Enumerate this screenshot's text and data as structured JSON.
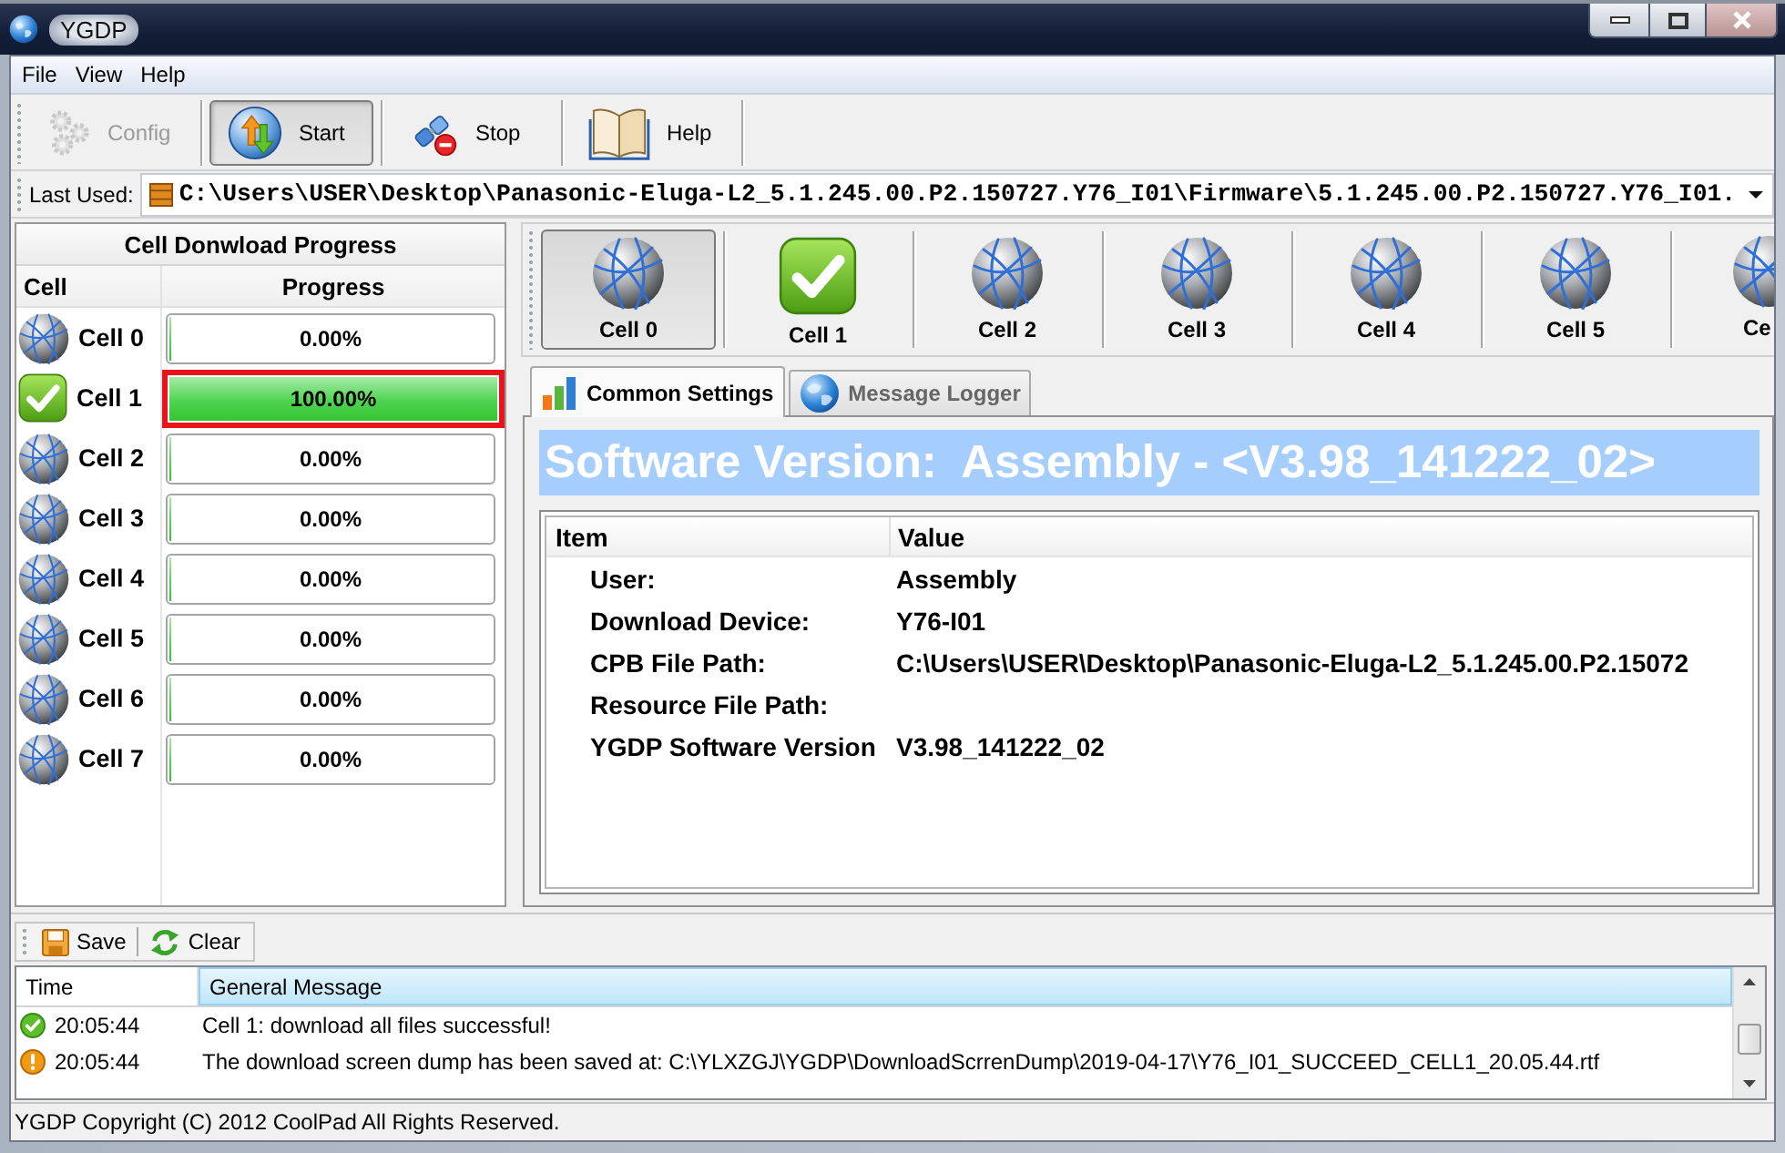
{
  "window": {
    "title": "YGDP"
  },
  "menu": [
    "File",
    "View",
    "Help"
  ],
  "toolbar": [
    {
      "label": "Config",
      "disabled": true,
      "pressed": false
    },
    {
      "label": "Start",
      "disabled": false,
      "pressed": true
    },
    {
      "label": "Stop",
      "disabled": false,
      "pressed": false
    },
    {
      "label": "Help",
      "disabled": false,
      "pressed": false
    }
  ],
  "last_used": {
    "label": "Last Used:",
    "value": "C:\\Users\\USER\\Desktop\\Panasonic-Eluga-L2_5.1.245.00.P2.150727.Y76_I01\\Firmware\\5.1.245.00.P2.150727.Y76_I01."
  },
  "progress_panel": {
    "title": "Cell Donwload Progress",
    "columns": [
      "Cell",
      "Progress"
    ],
    "rows": [
      {
        "name": "Cell 0",
        "done": false,
        "level": 0,
        "reading": "0.00%",
        "selected": false
      },
      {
        "name": "Cell 1",
        "done": true,
        "level": 1,
        "reading": "100.00%",
        "selected": true
      },
      {
        "name": "Cell 2",
        "done": false,
        "level": 0,
        "reading": "0.00%",
        "selected": false
      },
      {
        "name": "Cell 3",
        "done": false,
        "level": 0,
        "reading": "0.00%",
        "selected": false
      },
      {
        "name": "Cell 4",
        "done": false,
        "level": 0,
        "reading": "0.00%",
        "selected": false
      },
      {
        "name": "Cell 5",
        "done": false,
        "level": 0,
        "reading": "0.00%",
        "selected": false
      },
      {
        "name": "Cell 6",
        "done": false,
        "level": 0,
        "reading": "0.00%",
        "selected": false
      },
      {
        "name": "Cell 7",
        "done": false,
        "level": 0,
        "reading": "0.00%",
        "selected": false
      }
    ]
  },
  "cell_bar": [
    {
      "label": "Cell 0",
      "done": false,
      "selected": true
    },
    {
      "label": "Cell 1",
      "done": true,
      "selected": false
    },
    {
      "label": "Cell 2",
      "done": false,
      "selected": false
    },
    {
      "label": "Cell 3",
      "done": false,
      "selected": false
    },
    {
      "label": "Cell 4",
      "done": false,
      "selected": false
    },
    {
      "label": "Cell 5",
      "done": false,
      "selected": false
    },
    {
      "label": "Ce",
      "done": false,
      "selected": false
    }
  ],
  "tabs": [
    {
      "label": "Common Settings",
      "selected": true
    },
    {
      "label": "Message Logger",
      "selected": false
    }
  ],
  "banner": "Software Version:  Assembly - <V3.98_141222_02>",
  "info_table": {
    "columns": [
      "Item",
      "Value"
    ],
    "rows": [
      {
        "item": "User:",
        "value": "Assembly"
      },
      {
        "item": "Download Device:",
        "value": "Y76-I01"
      },
      {
        "item": "CPB File Path:",
        "value": "C:\\Users\\USER\\Desktop\\Panasonic-Eluga-L2_5.1.245.00.P2.15072"
      },
      {
        "item": "Resource File Path:"
      },
      {
        "item": "YGDP Software Version",
        "value": "V3.98_141222_02"
      }
    ]
  },
  "log": {
    "buttons": [
      "Save",
      "Clear"
    ],
    "columns": [
      {
        "label": "Time",
        "selected": false
      },
      {
        "label": "General Message",
        "selected": true
      }
    ],
    "rows": [
      {
        "kind": "success",
        "time": "20:05:44",
        "message": "Cell 1: download all files successful!"
      },
      {
        "kind": "warning",
        "time": "20:05:44",
        "message": "The download screen dump has been saved at: C:\\YLXZGJ\\YGDP\\DownloadScrrenDump\\2019-04-17\\Y76_I01_SUCCEED_CELL1_20.05.44.rtf"
      }
    ]
  },
  "status_bar": "YGDP Copyright (C) 2012 CoolPad All Rights Reserved."
}
